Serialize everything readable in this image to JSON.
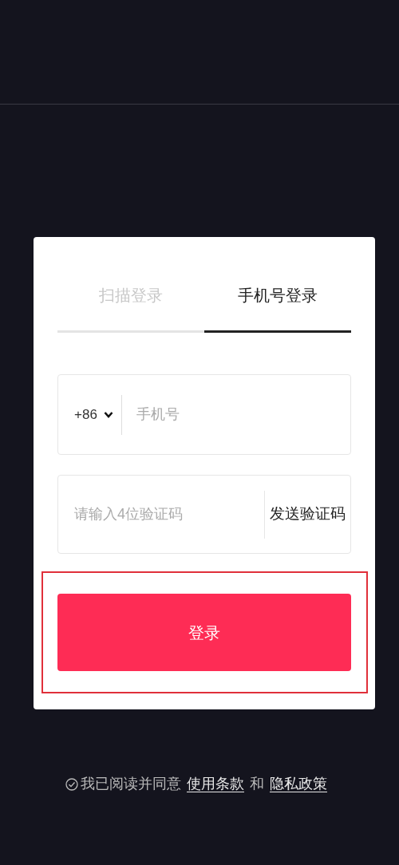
{
  "tabs": [
    {
      "label": "扫描登录",
      "selected": false
    },
    {
      "label": "手机号登录",
      "selected": true
    }
  ],
  "phone_field": {
    "country_code": "+86",
    "placeholder": "手机号"
  },
  "code_field": {
    "placeholder": "请输入4位验证码",
    "send_button": "发送验证码"
  },
  "login_button": {
    "label": "登录",
    "highlighted": true
  },
  "agreement": {
    "checked": true,
    "text": "我已阅读并同意",
    "terms_link": "使用条款",
    "joiner": "和",
    "privacy_link": "隐私政策"
  }
}
